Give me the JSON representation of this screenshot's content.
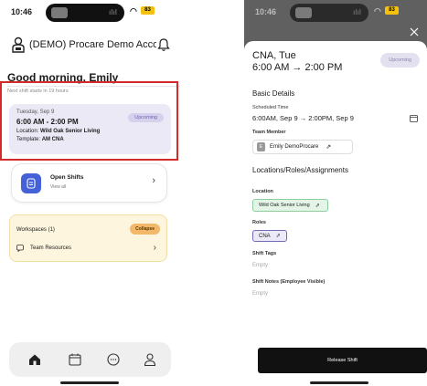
{
  "left": {
    "status": {
      "time": "10:46",
      "battery": "83"
    },
    "account": {
      "name": "(DEMO) Procare Demo Account"
    },
    "greeting": "Good morning, Emily",
    "next_shift_note": "Next shift starts in 19 hours",
    "shift": {
      "date": "Tuesday, Sep 9",
      "hours": "6:00 AM - 2:00 PM",
      "location_label": "Location: ",
      "location": "Wild Oak Senior Living",
      "template_label": "Template: ",
      "template": "AM CNA",
      "badge": "Upcoming"
    },
    "open_shifts": {
      "title": "Open Shifts",
      "subtitle": "View all"
    },
    "workspaces": {
      "title": "Workspaces (1)",
      "collapse": "Collapse",
      "item": "Team Resources"
    },
    "tabs": [
      "home",
      "calendar",
      "chat",
      "profile"
    ]
  },
  "right": {
    "status": {
      "time": "10:46",
      "battery": "83"
    },
    "header": {
      "title": "CNA, Tue",
      "time_range": "6:00 AM → 2:00 PM",
      "badge": "Upcoming"
    },
    "basic_details": "Basic Details",
    "scheduled_time_label": "Scheduled Time",
    "scheduled_time": "6:00AM, Sep 9 → 2:00PM, Sep 9",
    "team_member_label": "Team Member",
    "team_member_initial": "E",
    "team_member": "Emily DemoProcare",
    "assignments_title": "Locations/Roles/Assignments",
    "location_label": "Location",
    "location": "Wild Oak Senior Living",
    "roles_label": "Roles",
    "role": "CNA",
    "shift_tags_label": "Shift Tags",
    "shift_tags_value": "Empty",
    "shift_notes_label": "Shift Notes (Employee Visible)",
    "shift_notes_value": "Empty",
    "release_button": "Release Shift"
  }
}
